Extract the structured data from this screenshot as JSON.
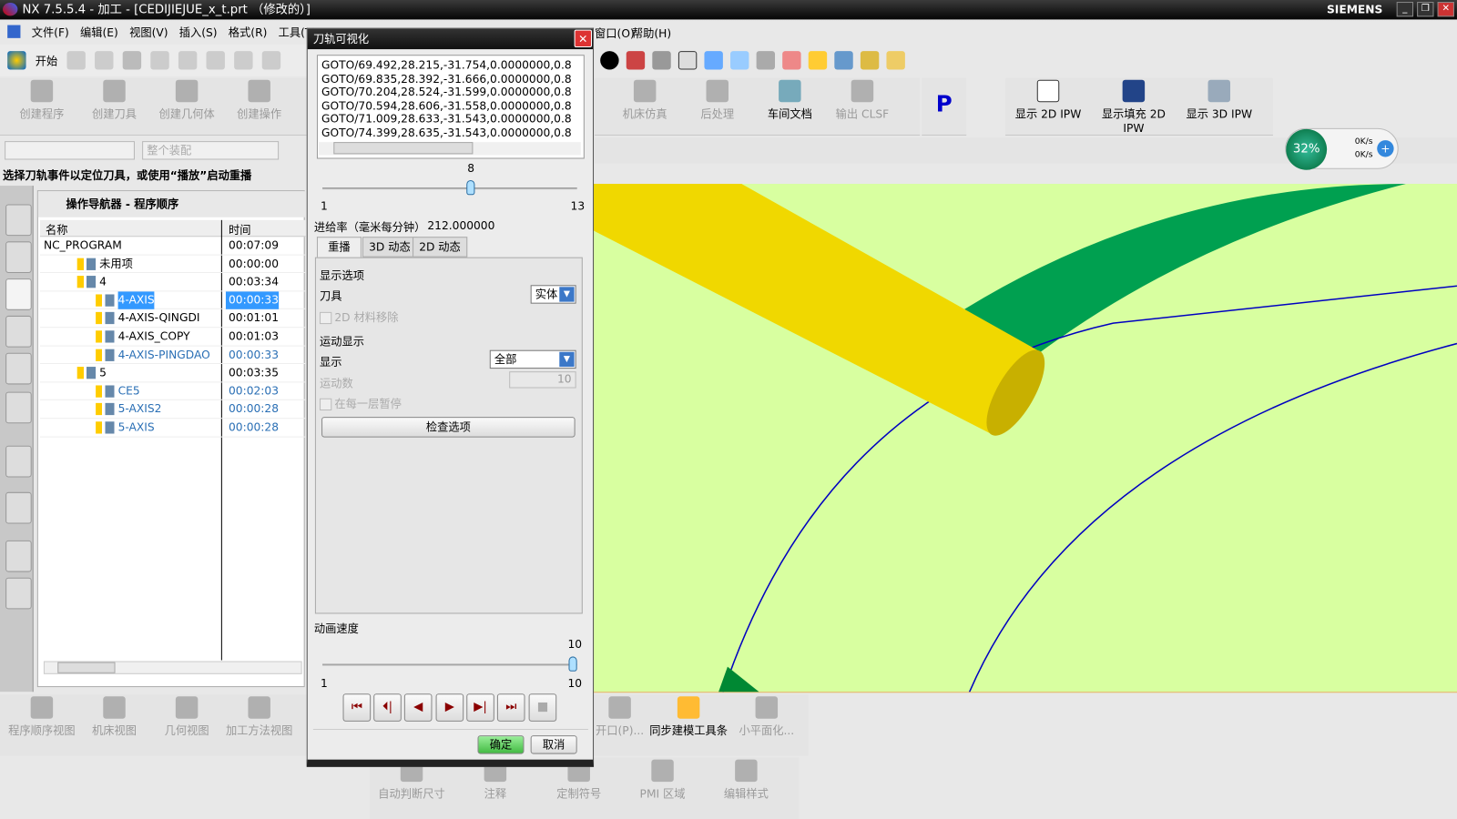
{
  "window": {
    "title": "NX 7.5.5.4 - 加工 - [CEDIJIEJUE_x_t.prt （修改的）]",
    "brand": "SIEMENS",
    "min": "_",
    "restore": "❐",
    "close": "✕"
  },
  "menu": [
    "文件(F)",
    "编辑(E)",
    "视图(V)",
    "插入(S)",
    "格式(R)",
    "工具(T)",
    "窗口(O)",
    "帮助(H)"
  ],
  "toolbar": {
    "start": "开始"
  },
  "ribbon_left": [
    {
      "label": "创建程序"
    },
    {
      "label": "创建刀具"
    },
    {
      "label": "创建几何体"
    },
    {
      "label": "创建操作"
    }
  ],
  "ribbon_right": [
    {
      "label": "机床仿真",
      "enabled": false
    },
    {
      "label": "后处理",
      "enabled": false
    },
    {
      "label": "车间文档",
      "enabled": true
    },
    {
      "label": "输出 CLSF",
      "enabled": false
    }
  ],
  "ipw": [
    {
      "label": "显示 2D IPW"
    },
    {
      "label": "显示填充 2D IPW"
    },
    {
      "label": "显示 3D IPW"
    }
  ],
  "filter": {
    "selection": "",
    "scope": "整个装配"
  },
  "hint": "选择刀轨事件以定位刀具，或使用“播放”启动重播",
  "netmeter": {
    "percent": "32%",
    "up": "0K/s",
    "down": "0K/s"
  },
  "navigator": {
    "title": "操作导航器 - 程序顺序",
    "columns": [
      "名称",
      "时间"
    ],
    "rows": [
      {
        "name": "NC_PROGRAM",
        "time": "00:07:09",
        "level": 0
      },
      {
        "name": "未用项",
        "time": "00:00:00",
        "level": 1
      },
      {
        "name": "4",
        "time": "00:03:34",
        "level": 1
      },
      {
        "name": "4-AXIS",
        "time": "00:00:33",
        "level": 2,
        "selected": true
      },
      {
        "name": "4-AXIS-QINGDI",
        "time": "00:01:01",
        "level": 2
      },
      {
        "name": "4-AXIS_COPY",
        "time": "00:01:03",
        "level": 2
      },
      {
        "name": "4-AXIS-PINGDAO",
        "time": "00:00:33",
        "level": 2,
        "blue": true
      },
      {
        "name": "5",
        "time": "00:03:35",
        "level": 1
      },
      {
        "name": "CE5",
        "time": "00:02:03",
        "level": 2,
        "blue": true
      },
      {
        "name": "5-AXIS2",
        "time": "00:00:28",
        "level": 2,
        "blue": true
      },
      {
        "name": "5-AXIS",
        "time": "00:00:28",
        "level": 2,
        "blue": true
      }
    ]
  },
  "bottom_left_tools": [
    "程序顺序视图",
    "机床视图",
    "几何视图",
    "加工方法视图"
  ],
  "bottom_right_tools": [
    "开口(P)...",
    "同步建模工具条",
    "小平面化..."
  ],
  "bottom_row2_tools": [
    "自动判断尺寸",
    "注释",
    "定制符号",
    "PMI 区域",
    "编辑样式"
  ],
  "dialog": {
    "title": "刀轨可视化",
    "lines": [
      "GOTO/69.492,28.215,-31.754,0.0000000,0.8",
      "GOTO/69.835,28.392,-31.666,0.0000000,0.8",
      "GOTO/70.204,28.524,-31.599,0.0000000,0.8",
      "GOTO/70.594,28.606,-31.558,0.0000000,0.8",
      "GOTO/71.009,28.633,-31.543,0.0000000,0.8",
      "GOTO/74.399,28.635,-31.543,0.0000000,0.8"
    ],
    "event_slider": {
      "value": "8",
      "min": "1",
      "max": "13"
    },
    "feed_label": "进给率（毫米每分钟）",
    "feed_value": "212.000000",
    "tabs": [
      "重播",
      "3D 动态",
      "2D 动态"
    ],
    "display_options": "显示选项",
    "tool_label": "刀具",
    "tool_value": "实体",
    "material_removal": "2D 材料移除",
    "motion_display": "运动显示",
    "display_label": "显示",
    "display_value": "全部",
    "motion_count_label": "运动数",
    "motion_count": "10",
    "pause_each": "在每一层暂停",
    "check_options": "检查选项",
    "speed_label": "动画速度",
    "speed_slider": {
      "value": "10",
      "min": "1",
      "max": "10"
    },
    "ok": "确定",
    "cancel": "取消"
  },
  "colors": {
    "part": "#d8ffa0",
    "green_wall": "#00a050",
    "tool": "#f0d800",
    "edge": "#0000c0",
    "selection": "#3399ff"
  }
}
